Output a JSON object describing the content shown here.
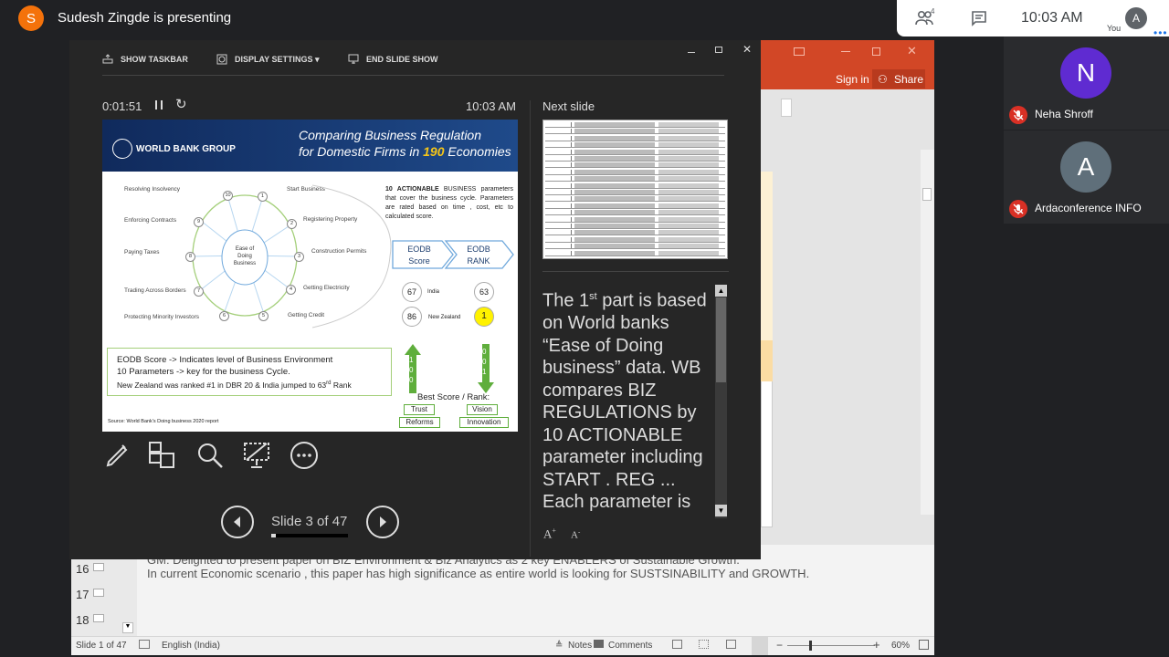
{
  "meeting": {
    "presenter_initial": "S",
    "presenter_status": "Sudesh Zingde is presenting",
    "people_count": "4",
    "time": "10:03 AM",
    "you_initial": "A",
    "you_label": "You",
    "participants": [
      {
        "initial": "N",
        "name": "Neha Shroff",
        "color": "#5f2bd1"
      },
      {
        "initial": "A",
        "name": "Ardaconference INFO",
        "color": "#5f6f7a"
      }
    ]
  },
  "presenter_view": {
    "toolbar": {
      "taskbar": "SHOW TASKBAR",
      "display": "DISPLAY SETTINGS ▾",
      "end": "END SLIDE SHOW"
    },
    "timer": "0:01:51",
    "clock": "10:03 AM",
    "next_slide_label": "Next slide",
    "slide_counter": "Slide 3 of 47",
    "notes_text": "The 1st part is based on World banks “Ease of Doing business” data. WB compares BIZ REGULATIONS by 10 ACTIONABLE parameter including START . REG ... Each parameter is"
  },
  "slide": {
    "logo": "WORLD BANK GROUP",
    "title_line1": "Comparing Business Regulation",
    "title_line2": "for Domestic Firms in ",
    "title_number": "190",
    "title_end": " Economies",
    "center": "Ease of Doing Business",
    "left_params": [
      "Resolving Insolvency",
      "Enforcing Contracts",
      "Paying Taxes",
      "Trading Across Borders",
      "Protecting Minority Investors"
    ],
    "right_params": [
      "Start Business",
      "Registering Property",
      "Construction Permits",
      "Getting Electricity",
      "Getting Credit"
    ],
    "nums": [
      "1",
      "2",
      "3",
      "4",
      "5",
      "6",
      "7",
      "8",
      "9",
      "10"
    ],
    "desc_bold": "10 ACTIONABLE",
    "desc_text": " BUSINESS parameters that cover the business cycle. Parameters are rated based on time , cost, etc to calculated score.",
    "score_label": "EODB Score",
    "rank_label": "EODB RANK",
    "rows": [
      {
        "score": "67",
        "country": "India",
        "rank": "63"
      },
      {
        "score": "86",
        "country": "New Zealand",
        "rank": "1"
      }
    ],
    "box_lines": [
      "EODB Score -> Indicates level of Business Environment",
      "10 Parameters -> key for the business Cycle.",
      "New Zealand was ranked #1 in DBR 20 & India jumped to 63rd Rank"
    ],
    "arrow_up": "100",
    "arrow_down": "001",
    "best": "Best Score / Rank:",
    "tags": [
      "Trust",
      "Vision",
      "Reforms",
      "Innovation"
    ],
    "source": "Source: World Bank's Doing business 2020 report"
  },
  "ppt": {
    "sign_in": "Sign in",
    "share": "Share",
    "notes_line1": "GM: Delighted to present paper on BIZ Environment & Biz Analytics as 2 key ENABLERS of Sustainable Growth.",
    "notes_line2": "In current Economic scenario , this paper has high significance as entire world is looking for SUSTSINABILITY and GROWTH.",
    "thumbs": [
      "16",
      "17",
      "18"
    ],
    "status_slide": "Slide 1 of 47",
    "language": "English (India)",
    "notes_btn": "Notes",
    "comments_btn": "Comments",
    "zoom": "60%"
  }
}
